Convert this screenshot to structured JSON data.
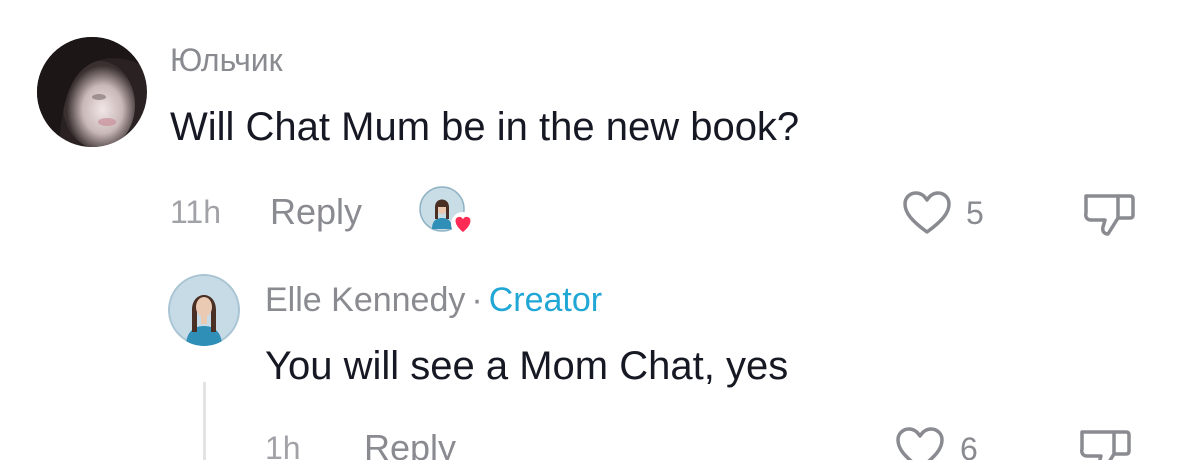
{
  "comment": {
    "username": "Юльчик",
    "text": "Will Chat Mum be in the new book?",
    "time": "11h",
    "reply_label": "Reply",
    "likes": "5",
    "liked_by_creator": true
  },
  "reply": {
    "author": "Elle Kennedy",
    "separator": "·",
    "badge": "Creator",
    "text": "You will see a Mom Chat, yes",
    "time": "1h",
    "reply_label": "Reply",
    "likes": "6"
  },
  "colors": {
    "text_primary": "#161823",
    "text_secondary": "#8a8b91",
    "creator_badge": "#20a7d6",
    "heart_badge": "#fe2c55"
  },
  "icons": {
    "like": "heart-outline-icon",
    "dislike": "thumbs-down-icon",
    "creator_like": "heart-filled-icon"
  }
}
